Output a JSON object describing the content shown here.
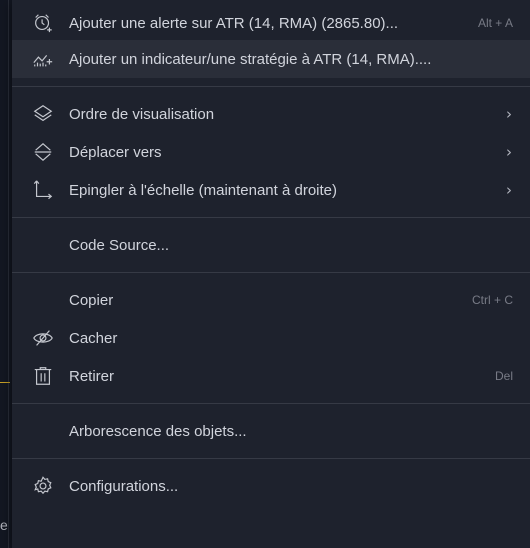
{
  "background": {
    "edge_text": "e"
  },
  "colors": {
    "menu_bg": "#1e222d",
    "hover_bg": "#2a2e39",
    "text": "#d1d4dc",
    "shortcut_text": "#787b86",
    "separator": "#363a45"
  },
  "menu": {
    "items": [
      {
        "label": "Ajouter une alerte sur ATR (14, RMA) (2865.80)...",
        "shortcut": "Alt + A",
        "icon": "alarm-clock-plus-icon"
      },
      {
        "label": "Ajouter un indicateur/une stratégie à ATR (14, RMA)....",
        "icon": "indicator-plus-icon"
      },
      {
        "label": "Ordre de visualisation",
        "chevron": "›",
        "icon": "layers-icon"
      },
      {
        "label": "Déplacer vers",
        "chevron": "›",
        "icon": "move-updown-icon"
      },
      {
        "label": "Epingler à l'échelle (maintenant à droite)",
        "chevron": "›",
        "icon": "pin-scale-icon"
      },
      {
        "label": "Code Source..."
      },
      {
        "label": "Copier",
        "shortcut": "Ctrl + C"
      },
      {
        "label": "Cacher",
        "icon": "eye-hidden-icon"
      },
      {
        "label": "Retirer",
        "shortcut": "Del",
        "icon": "trash-icon"
      },
      {
        "label": "Arborescence des objets..."
      },
      {
        "label": "Configurations...",
        "icon": "gear-icon"
      }
    ]
  }
}
